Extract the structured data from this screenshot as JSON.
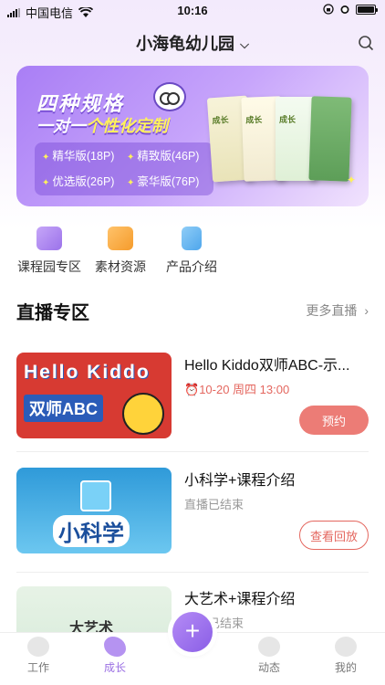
{
  "status": {
    "carrier": "中国电信",
    "time": "10:16"
  },
  "header": {
    "title": "小海龟幼儿园"
  },
  "banner": {
    "line1": "四种规格",
    "line2_prefix": "一对一",
    "line2_highlight": "个性化定制",
    "specs": [
      "精华版(18P)",
      "精致版(46P)",
      "优选版(26P)",
      "豪华版(76P)"
    ]
  },
  "quick_links": [
    "课程园专区",
    "素材资源",
    "产品介绍"
  ],
  "live": {
    "title": "直播专区",
    "more": "更多直播",
    "items": [
      {
        "title": "Hello Kiddo双师ABC-示...",
        "sub": "10-20 周四 13:00",
        "button": "预约",
        "thumb_line1": "Hello Kiddo",
        "thumb_line2": "双师ABC"
      },
      {
        "title": "小科学+课程介绍",
        "sub": "直播已结束",
        "button": "查看回放",
        "thumb_line1": "小科学"
      },
      {
        "title": "大艺术+课程介绍",
        "sub": "直播已结束",
        "thumb_line1": "大艺术"
      }
    ]
  },
  "tabbar": [
    "工作",
    "成长",
    "动态",
    "我的"
  ],
  "fab": "+",
  "colors": {
    "accent": "#9a6fe3",
    "alert": "#e4675f"
  }
}
